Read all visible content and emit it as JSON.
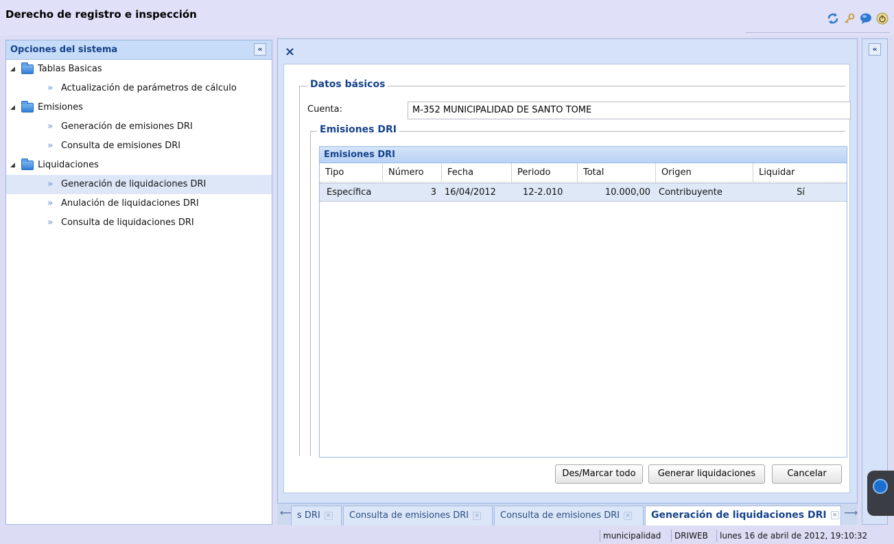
{
  "app": {
    "title": "Derecho de registro e inspección"
  },
  "header_icons": [
    "refresh-icon",
    "key-icon",
    "chat-icon",
    "power-icon"
  ],
  "left_panel": {
    "title": "Opciones del sistema",
    "collapse": "«",
    "tree": [
      {
        "label": "Tablas Basicas",
        "children": [
          "Actualización de parámetros de cálculo"
        ]
      },
      {
        "label": "Emisiones",
        "children": [
          "Generación de emisiones DRI",
          "Consulta de emisiones DRI"
        ]
      },
      {
        "label": "Liquidaciones",
        "children": [
          "Generación de liquidaciones DRI",
          "Anulación de liquidaciones DRI",
          "Consulta de liquidaciones DRI"
        ]
      }
    ],
    "selected": "Generación de liquidaciones DRI"
  },
  "main": {
    "close": "×",
    "datos_basicos": {
      "legend": "Datos básicos",
      "cuenta_label": "Cuenta:",
      "cuenta_value": "M-352 MUNICIPALIDAD DE SANTO TOME"
    },
    "emisiones": {
      "legend": "Emisiones DRI",
      "grid_title": "Emisiones DRI",
      "columns": [
        "Tipo",
        "Número",
        "Fecha",
        "Periodo",
        "Total",
        "Origen",
        "Liquidar"
      ],
      "rows": [
        {
          "tipo": "Específica",
          "numero": "3",
          "fecha": "16/04/2012",
          "periodo": "12-2.010",
          "total": "10.000,00",
          "origen": "Contribuyente",
          "liquidar": "Sí"
        }
      ]
    },
    "buttons": {
      "toggle_all": "Des/Marcar todo",
      "generate": "Generar liquidaciones",
      "cancel": "Cancelar"
    }
  },
  "tabs": [
    {
      "label": "s DRI",
      "active": false
    },
    {
      "label": "Consulta de emisiones DRI",
      "active": false
    },
    {
      "label": "Consulta de emisiones DRI",
      "active": false
    },
    {
      "label": "Generación de liquidaciones DRI",
      "active": true
    }
  ],
  "tab_close": "×",
  "right_panel": {
    "collapse": "«"
  },
  "status": {
    "user": "municipalidad",
    "system": "DRIWEB",
    "datetime": "lunes 16 de abril de 2012, 19:10:32"
  }
}
